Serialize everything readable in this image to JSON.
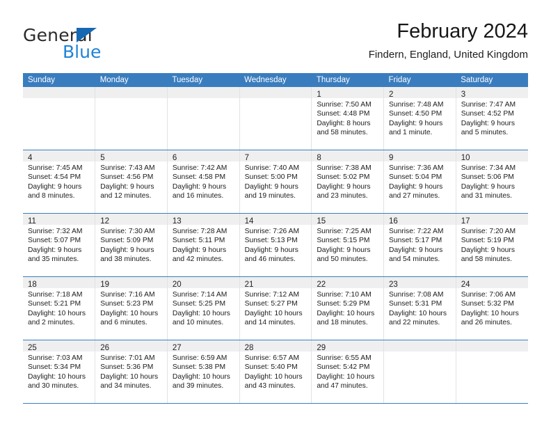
{
  "brand": {
    "name_top": "General",
    "name_bottom": "Blue",
    "color_dark": "#2b2b2b",
    "color_blue": "#1f83d6",
    "triangle_color": "#1668b3"
  },
  "header": {
    "title": "February 2024",
    "subtitle": "Findern, England, United Kingdom"
  },
  "theme": {
    "header_row_bg": "#3a7dbf",
    "header_row_text": "#ffffff",
    "daynum_band_bg": "#efefef",
    "row_separator": "#3a7dbf",
    "cell_bg": "#ffffff"
  },
  "calendar": {
    "weekday_headers": [
      "Sunday",
      "Monday",
      "Tuesday",
      "Wednesday",
      "Thursday",
      "Friday",
      "Saturday"
    ],
    "weeks": [
      [
        {
          "day": "",
          "lines": []
        },
        {
          "day": "",
          "lines": []
        },
        {
          "day": "",
          "lines": []
        },
        {
          "day": "",
          "lines": []
        },
        {
          "day": "1",
          "lines": [
            "Sunrise: 7:50 AM",
            "Sunset: 4:48 PM",
            "Daylight: 8 hours",
            "and 58 minutes."
          ]
        },
        {
          "day": "2",
          "lines": [
            "Sunrise: 7:48 AM",
            "Sunset: 4:50 PM",
            "Daylight: 9 hours",
            "and 1 minute."
          ]
        },
        {
          "day": "3",
          "lines": [
            "Sunrise: 7:47 AM",
            "Sunset: 4:52 PM",
            "Daylight: 9 hours",
            "and 5 minutes."
          ]
        }
      ],
      [
        {
          "day": "4",
          "lines": [
            "Sunrise: 7:45 AM",
            "Sunset: 4:54 PM",
            "Daylight: 9 hours",
            "and 8 minutes."
          ]
        },
        {
          "day": "5",
          "lines": [
            "Sunrise: 7:43 AM",
            "Sunset: 4:56 PM",
            "Daylight: 9 hours",
            "and 12 minutes."
          ]
        },
        {
          "day": "6",
          "lines": [
            "Sunrise: 7:42 AM",
            "Sunset: 4:58 PM",
            "Daylight: 9 hours",
            "and 16 minutes."
          ]
        },
        {
          "day": "7",
          "lines": [
            "Sunrise: 7:40 AM",
            "Sunset: 5:00 PM",
            "Daylight: 9 hours",
            "and 19 minutes."
          ]
        },
        {
          "day": "8",
          "lines": [
            "Sunrise: 7:38 AM",
            "Sunset: 5:02 PM",
            "Daylight: 9 hours",
            "and 23 minutes."
          ]
        },
        {
          "day": "9",
          "lines": [
            "Sunrise: 7:36 AM",
            "Sunset: 5:04 PM",
            "Daylight: 9 hours",
            "and 27 minutes."
          ]
        },
        {
          "day": "10",
          "lines": [
            "Sunrise: 7:34 AM",
            "Sunset: 5:06 PM",
            "Daylight: 9 hours",
            "and 31 minutes."
          ]
        }
      ],
      [
        {
          "day": "11",
          "lines": [
            "Sunrise: 7:32 AM",
            "Sunset: 5:07 PM",
            "Daylight: 9 hours",
            "and 35 minutes."
          ]
        },
        {
          "day": "12",
          "lines": [
            "Sunrise: 7:30 AM",
            "Sunset: 5:09 PM",
            "Daylight: 9 hours",
            "and 38 minutes."
          ]
        },
        {
          "day": "13",
          "lines": [
            "Sunrise: 7:28 AM",
            "Sunset: 5:11 PM",
            "Daylight: 9 hours",
            "and 42 minutes."
          ]
        },
        {
          "day": "14",
          "lines": [
            "Sunrise: 7:26 AM",
            "Sunset: 5:13 PM",
            "Daylight: 9 hours",
            "and 46 minutes."
          ]
        },
        {
          "day": "15",
          "lines": [
            "Sunrise: 7:25 AM",
            "Sunset: 5:15 PM",
            "Daylight: 9 hours",
            "and 50 minutes."
          ]
        },
        {
          "day": "16",
          "lines": [
            "Sunrise: 7:22 AM",
            "Sunset: 5:17 PM",
            "Daylight: 9 hours",
            "and 54 minutes."
          ]
        },
        {
          "day": "17",
          "lines": [
            "Sunrise: 7:20 AM",
            "Sunset: 5:19 PM",
            "Daylight: 9 hours",
            "and 58 minutes."
          ]
        }
      ],
      [
        {
          "day": "18",
          "lines": [
            "Sunrise: 7:18 AM",
            "Sunset: 5:21 PM",
            "Daylight: 10 hours",
            "and 2 minutes."
          ]
        },
        {
          "day": "19",
          "lines": [
            "Sunrise: 7:16 AM",
            "Sunset: 5:23 PM",
            "Daylight: 10 hours",
            "and 6 minutes."
          ]
        },
        {
          "day": "20",
          "lines": [
            "Sunrise: 7:14 AM",
            "Sunset: 5:25 PM",
            "Daylight: 10 hours",
            "and 10 minutes."
          ]
        },
        {
          "day": "21",
          "lines": [
            "Sunrise: 7:12 AM",
            "Sunset: 5:27 PM",
            "Daylight: 10 hours",
            "and 14 minutes."
          ]
        },
        {
          "day": "22",
          "lines": [
            "Sunrise: 7:10 AM",
            "Sunset: 5:29 PM",
            "Daylight: 10 hours",
            "and 18 minutes."
          ]
        },
        {
          "day": "23",
          "lines": [
            "Sunrise: 7:08 AM",
            "Sunset: 5:31 PM",
            "Daylight: 10 hours",
            "and 22 minutes."
          ]
        },
        {
          "day": "24",
          "lines": [
            "Sunrise: 7:06 AM",
            "Sunset: 5:32 PM",
            "Daylight: 10 hours",
            "and 26 minutes."
          ]
        }
      ],
      [
        {
          "day": "25",
          "lines": [
            "Sunrise: 7:03 AM",
            "Sunset: 5:34 PM",
            "Daylight: 10 hours",
            "and 30 minutes."
          ]
        },
        {
          "day": "26",
          "lines": [
            "Sunrise: 7:01 AM",
            "Sunset: 5:36 PM",
            "Daylight: 10 hours",
            "and 34 minutes."
          ]
        },
        {
          "day": "27",
          "lines": [
            "Sunrise: 6:59 AM",
            "Sunset: 5:38 PM",
            "Daylight: 10 hours",
            "and 39 minutes."
          ]
        },
        {
          "day": "28",
          "lines": [
            "Sunrise: 6:57 AM",
            "Sunset: 5:40 PM",
            "Daylight: 10 hours",
            "and 43 minutes."
          ]
        },
        {
          "day": "29",
          "lines": [
            "Sunrise: 6:55 AM",
            "Sunset: 5:42 PM",
            "Daylight: 10 hours",
            "and 47 minutes."
          ]
        },
        {
          "day": "",
          "lines": []
        },
        {
          "day": "",
          "lines": []
        }
      ]
    ]
  }
}
